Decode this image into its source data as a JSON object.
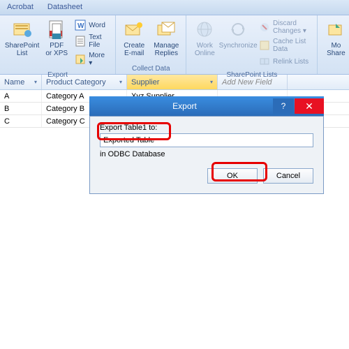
{
  "tabs": [
    "Acrobat",
    "Datasheet"
  ],
  "ribbon": {
    "export": {
      "sharepoint": "SharePoint\nList",
      "pdf": "PDF\nor XPS",
      "word": "Word",
      "textfile": "Text File",
      "more": "More ▾",
      "group_label": "Export"
    },
    "collect": {
      "create_email": "Create\nE-mail",
      "manage_replies": "Manage\nReplies",
      "group_label": "Collect Data"
    },
    "web": {
      "work_online": "Work\nOnline",
      "synchronize": "Synchronize"
    },
    "sharepoint": {
      "discard": "Discard Changes ▾",
      "cache": "Cache List Data",
      "relink": "Relink Lists",
      "group_label": "SharePoint Lists"
    },
    "move": {
      "label": "Mo\nShare"
    }
  },
  "grid": {
    "columns": [
      "Name",
      "Product Category",
      "Supplier",
      "Add New Field"
    ],
    "rows": [
      {
        "name": "A",
        "category": "Category A",
        "supplier": "Xyz Supplier"
      },
      {
        "name": "B",
        "category": "Category B",
        "supplier": ""
      },
      {
        "name": "C",
        "category": "Category C",
        "supplier": ""
      }
    ]
  },
  "dialog": {
    "title": "Export",
    "label": "Export Table1 to:",
    "value": "Exported Table",
    "sub": "in ODBC Database",
    "ok": "OK",
    "cancel": "Cancel"
  }
}
